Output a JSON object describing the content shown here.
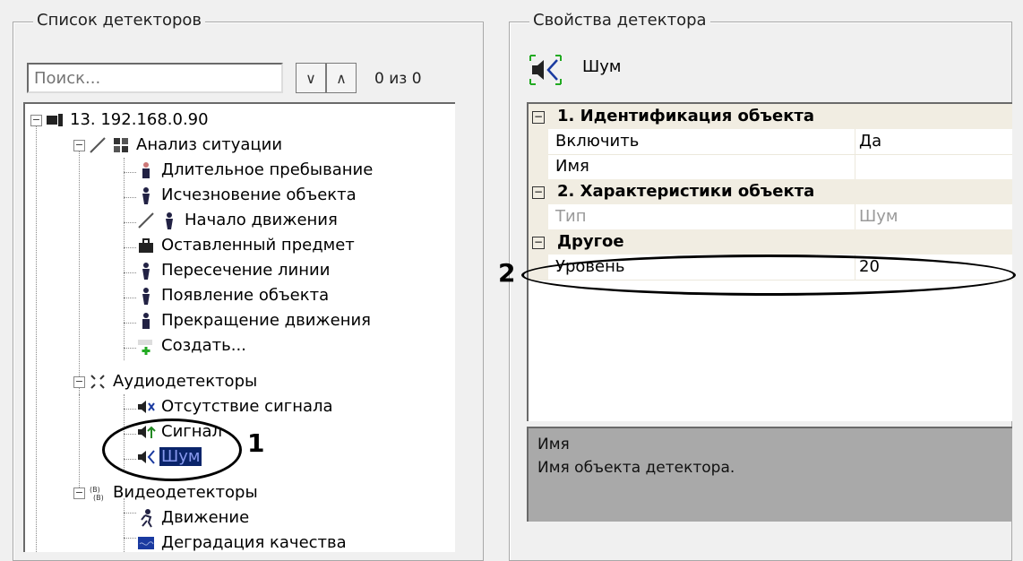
{
  "left_panel": {
    "title": "Список детекторов",
    "search_placeholder": "Поиск...",
    "down_symbol": "∨",
    "up_symbol": "∧",
    "counter": "0 из 0"
  },
  "tree": {
    "root": "13. 192.168.0.90",
    "analysis": {
      "label": "Анализ ситуации",
      "items": [
        "Длительное пребывание",
        "Исчезновение объекта",
        "Начало движения",
        "Оставленный предмет",
        "Пересечение линии",
        "Появление объекта",
        "Прекращение движения",
        "Создать..."
      ]
    },
    "audio": {
      "label": "Аудиодетекторы",
      "items": [
        "Отсутствие сигнала",
        "Сигнал",
        "Шум"
      ]
    },
    "video": {
      "label": "Видеодетекторы",
      "items": [
        "Движение",
        "Деградация качества"
      ]
    }
  },
  "right_panel": {
    "title": "Свойства детектора",
    "detector_name": "Шум"
  },
  "properties": {
    "cat1": "1. Идентификация объекта",
    "enable_label": "Включить",
    "enable_value": "Да",
    "name_label": "Имя",
    "name_value": "",
    "cat2": "2. Характеристики объекта",
    "type_label": "Тип",
    "type_value": "Шум",
    "cat3": "Другое",
    "level_label": "Уровень",
    "level_value": "20"
  },
  "description": {
    "name": "Имя",
    "text": "Имя объекта детектора."
  },
  "annotations": {
    "marker1": "1",
    "marker2": "2"
  },
  "colors": {
    "selection_bg": "#0a246a",
    "category_bg": "#f1ede2",
    "description_bg": "#a9a9a9"
  }
}
